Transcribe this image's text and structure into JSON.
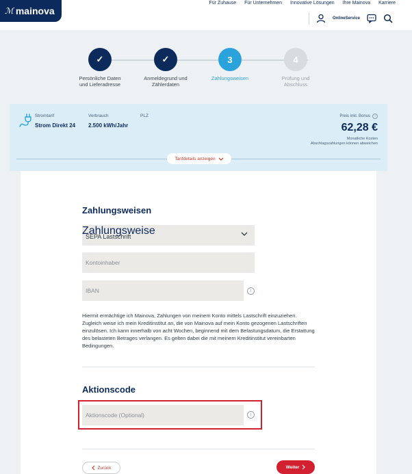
{
  "brand": {
    "logo_mark": "ℳ",
    "logo_text": "mainova",
    "primary_color": "#0c2a5c",
    "accent_color": "#2aa3dc",
    "action_color": "#d22030"
  },
  "topnav": [
    "Für Zuhause",
    "Für Unternehmen",
    "Innovative Lösungen",
    "Ihre Mainova",
    "Karriere"
  ],
  "toolbar": {
    "online_service": "OnlineService",
    "icons": [
      "user-icon",
      "chat-icon",
      "search-icon"
    ]
  },
  "steps": [
    {
      "number": "✓",
      "label_1": "Persönliche Daten",
      "label_2": "und Lieferadresse",
      "state": "done"
    },
    {
      "number": "✓",
      "label_1": "Anmeldegrund und",
      "label_2": "Zählerdaten",
      "state": "done"
    },
    {
      "number": "3",
      "label_1": "Zahlungsweisen",
      "label_2": "",
      "state": "active"
    },
    {
      "number": "4",
      "label_1": "Prüfung und",
      "label_2": "Abschluss",
      "state": "todo"
    }
  ],
  "tariff": {
    "stromtarif_cap": "Stromtarif",
    "stromtarif_val": "Strom Direkt 24",
    "verbrauch_cap": "Verbrauch",
    "verbrauch_val": "2.500 kWh/Jahr",
    "plz_cap": "PLZ",
    "plz_val": "",
    "price_cap": "Preis inkl. Bonus",
    "price": "62,28 €",
    "price_note_1": "Monatliche Kosten",
    "price_note_2": "Abschlagszahlungen können abweichen",
    "details_button": "Tarifdetails anzeigen"
  },
  "payment": {
    "heading": "Zahlungsweisen",
    "method_label": "Zahlungsweise",
    "method_value": "SEPA Lastschrift",
    "account_holder_placeholder": "Kontoinhaber",
    "iban_placeholder": "IBAN",
    "legal_text": "Hiermit ermächtige ich Mainova, Zahlungen von meinem Konto mittels Lastschrift einzuziehen. Zugleich weise ich mein Kreditinstitut an, die von Mainova auf mein Konto gezogenen Lastschriften einzulösen. Ich kann innerhalb von acht Wochen, beginnend mit dem Belastungsdatum, die Erstattung des belasteten Betrages verlangen. Es gelten dabei die mit meinem Kreditinstitut vereinbarten Bedingungen."
  },
  "promo": {
    "heading": "Aktionscode",
    "placeholder": "Aktionscode (Optional)"
  },
  "nav": {
    "back": "Zurück",
    "next": "Weiter"
  }
}
